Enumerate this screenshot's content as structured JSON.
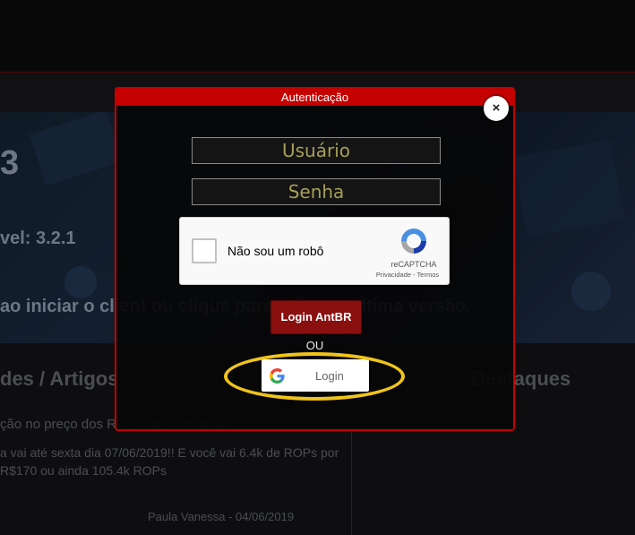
{
  "background": {
    "hero_number": "3",
    "hero_version": "vel: 3.2.1",
    "hero_notice": "ao iniciar o client ou clique para baixar a ultima versão.",
    "section_left": "des / Artigos",
    "section_right": "Destaques",
    "article_title": "ção no preço dos ROPs até 7/06/2019",
    "article_body": "a vai até sexta dia 07/06/2019!!    E você vai 6.4k de ROPs por R$170 ou ainda 105.4k ROPs",
    "article_author": "Paula Vanessa - 04/06/2019"
  },
  "modal": {
    "title": "Autenticação",
    "close_label": "×",
    "username_placeholder": "Usuário",
    "password_placeholder": "Senha",
    "recaptcha": {
      "label": "Não sou um robô",
      "brand": "reCAPTCHA",
      "links": "Privacidade - Termos"
    },
    "login_antbr": "Login AntBR",
    "or_label": "OU",
    "google_login": "Login"
  },
  "colors": {
    "accent": "#c40000",
    "field_text": "#a69f58",
    "highlight": "#f0c419"
  }
}
